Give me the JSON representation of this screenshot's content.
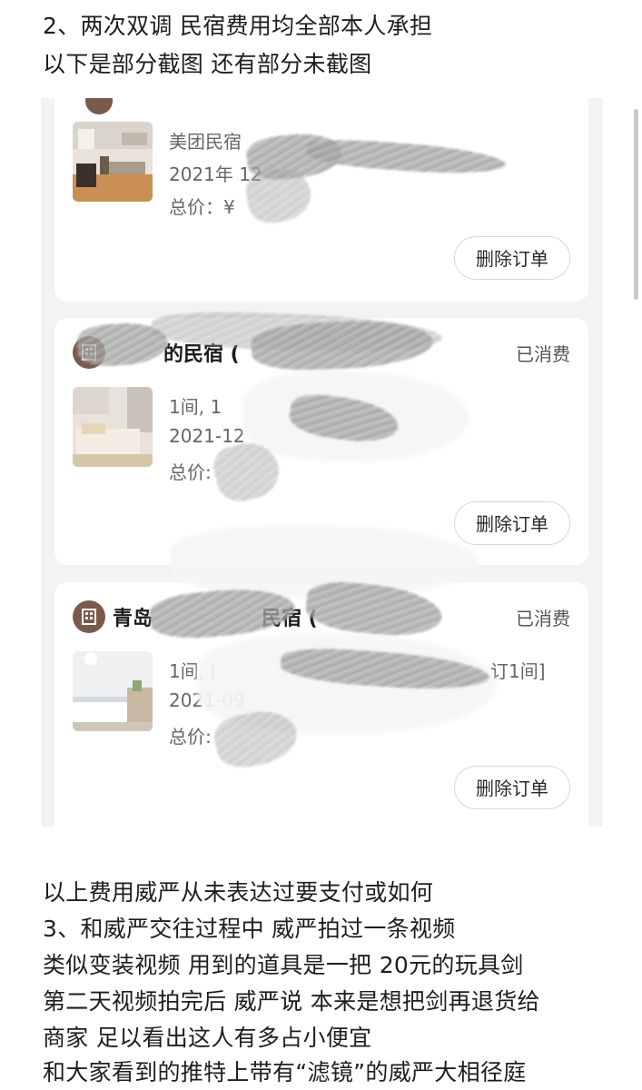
{
  "post_top": {
    "line1": "2、两次双调 民宿费用均全部本人承担",
    "line2": "以下是部分截图 还有部分未截图"
  },
  "orders": [
    {
      "shop_name": "",
      "status": "",
      "line1": "美团民宿",
      "line2": "2021年 12",
      "line3": "总价：¥",
      "button": "删除订单"
    },
    {
      "shop_name": "的民宿 (",
      "status": "已消费",
      "line1": "1间, 1",
      "line2": "2021-12",
      "line3": "总价:",
      "button": "删除订单"
    },
    {
      "shop_name": "青岛",
      "shop_name_right": "民宿 (",
      "status": "已消费",
      "line1": "1间, [",
      "line1_right": "订1间]",
      "line2": "2021-09",
      "line3": "总价:",
      "button": "删除订单"
    }
  ],
  "post_bottom": {
    "line1": "以上费用威严从未表达过要支付或如何",
    "line2": "3、和威严交往过程中 威严拍过一条视频",
    "line3": "类似变装视频 用到的道具是一把 20元的玩具剑",
    "line4": "第二天视频拍完后 威严说 本来是想把剑再退货给",
    "line5": "商家 足以看出这人有多占小便宜",
    "line6": "和大家看到的推特上带有“滤镜”的威严大相径庭"
  },
  "colors": {
    "shop_icon": "#7a5a4c",
    "status_text": "#555555",
    "card_bg": "#ffffff",
    "screenshot_bg": "#f3f3f3"
  }
}
